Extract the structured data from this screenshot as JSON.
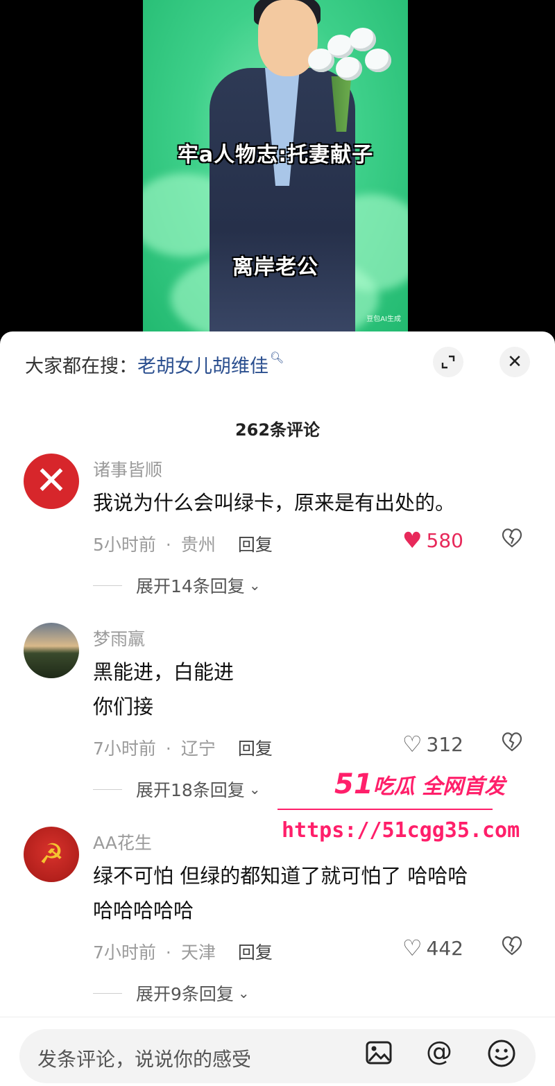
{
  "video": {
    "caption_top": "牢a人物志:托妻献子",
    "caption_bottom": "离岸老公",
    "watermark": "豆包AI生成"
  },
  "search": {
    "prefix": "大家都在搜：",
    "keyword": "老胡女儿胡维佳"
  },
  "comment_count": "262条评论",
  "comments": [
    {
      "username": "诸事皆顺",
      "text_lines": [
        "我说为什么会叫绿卡，原来是有出处的。"
      ],
      "time": "5小时前",
      "location": "贵州",
      "reply_label": "回复",
      "likes": "580",
      "liked": true,
      "expand": "展开14条回复"
    },
    {
      "username": "梦雨羸",
      "text_lines": [
        "黑能进，白能进",
        "你们接"
      ],
      "time": "7小时前",
      "location": "辽宁",
      "reply_label": "回复",
      "likes": "312",
      "liked": false,
      "expand": "展开18条回复"
    },
    {
      "username": "AA花生",
      "text_lines": [
        "绿不可怕 但绿的都知道了就可怕了 哈哈哈",
        "哈哈哈哈哈"
      ],
      "time": "7小时前",
      "location": "天津",
      "reply_label": "回复",
      "likes": "442",
      "liked": false,
      "expand": "展开9条回复"
    }
  ],
  "overlay_watermark": {
    "brand_num": "51",
    "brand_text": "吃瓜 全网首发",
    "url": "https://51cgg35.com"
  },
  "input": {
    "placeholder": "发条评论，说说你的感受"
  },
  "colors": {
    "like_active": "#e7295a",
    "keyword": "#2b4f8f",
    "watermark": "#ff1f6a"
  }
}
